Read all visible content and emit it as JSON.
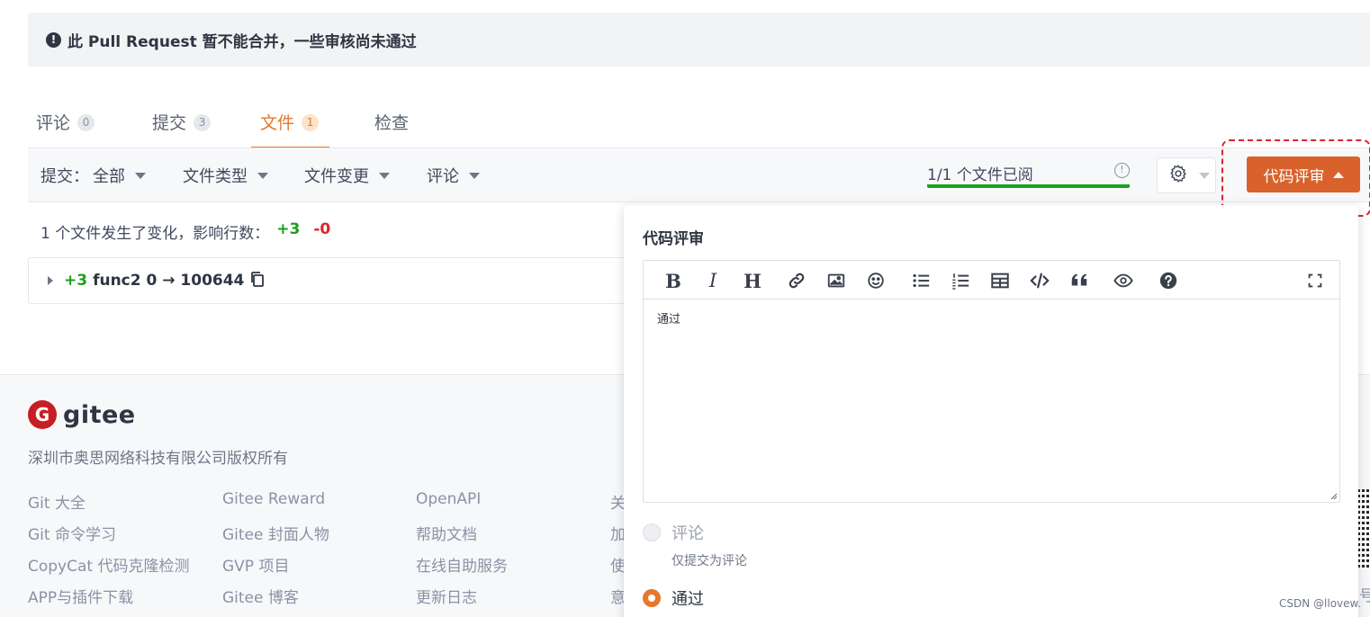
{
  "banner": {
    "icon": "exclamation-icon",
    "text": "此 Pull Request 暂不能合并，一些审核尚未通过"
  },
  "tabs": [
    {
      "label": "评论",
      "count": "0"
    },
    {
      "label": "提交",
      "count": "3"
    },
    {
      "label": "文件",
      "count": "1"
    },
    {
      "label": "检查",
      "count": ""
    }
  ],
  "filters": {
    "commits_label": "提交：",
    "commits_value": "全部",
    "file_type": "文件类型",
    "file_change": "文件变更",
    "comments": "评论"
  },
  "viewed": {
    "text": "1/1 个文件已阅"
  },
  "review_button": {
    "label": "代码评审"
  },
  "change_summary": {
    "text": "1 个文件发生了变化，影响行数：",
    "added": "+3",
    "removed": "-0"
  },
  "file": {
    "added": "+3",
    "name": "func2 0 → 100644"
  },
  "footer": {
    "logo_text": "gitee",
    "logo_mark": "G",
    "company": "深圳市奥思网络科技有限公司版权所有",
    "col1": [
      "Git 大全",
      "Git 命令学习",
      "CopyCat 代码克隆检测",
      "APP与插件下载"
    ],
    "col2": [
      "Gitee Reward",
      "Gitee 封面人物",
      "GVP 项目",
      "Gitee 博客"
    ],
    "col3": [
      "OpenAPI",
      "帮助文档",
      "在线自助服务",
      "更新日志"
    ],
    "col4": [
      "关",
      "加",
      "使",
      "意"
    ],
    "side_char": "号"
  },
  "review_panel": {
    "title": "代码评审",
    "editor_text": "通过",
    "toolbar_icons": [
      "bold-icon",
      "italic-icon",
      "heading-icon",
      "link-icon",
      "image-icon",
      "emoji-icon",
      "bullet-list-icon",
      "numbered-list-icon",
      "table-icon",
      "code-icon",
      "quote-icon",
      "preview-icon",
      "help-icon",
      "fullscreen-icon"
    ],
    "options": [
      {
        "label": "评论",
        "hint": "仅提交为评论",
        "state": "disabled"
      },
      {
        "label": "通过",
        "state": "checked"
      }
    ]
  },
  "watermark": "CSDN @llovew.",
  "colors": {
    "accent": "#e5782c",
    "review_button": "#d9622c",
    "added": "#1aa11a",
    "removed": "#d9262c",
    "progress": "#1aa11a"
  }
}
